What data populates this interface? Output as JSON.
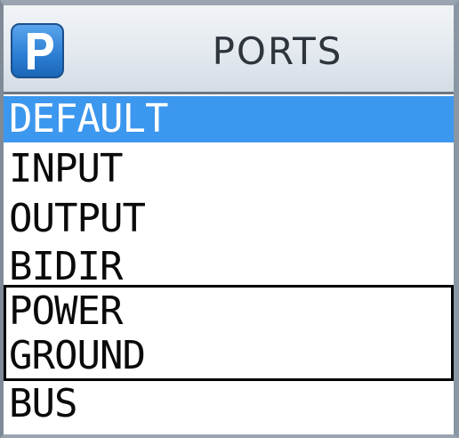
{
  "header": {
    "icon": "ports-p-icon",
    "icon_letter": "P",
    "title": "PORTS"
  },
  "ports_list": {
    "items": [
      {
        "label": "DEFAULT",
        "selected": true
      },
      {
        "label": "INPUT",
        "selected": false
      },
      {
        "label": "OUTPUT",
        "selected": false
      },
      {
        "label": "BIDIR",
        "selected": false
      },
      {
        "label": "POWER",
        "selected": false,
        "outlined": true
      },
      {
        "label": "GROUND",
        "selected": false,
        "outlined": true
      },
      {
        "label": "BUS",
        "selected": false
      }
    ]
  },
  "colors": {
    "selection": "#3c97ee",
    "icon_blue": "#2b7ed4",
    "outline": "#000000"
  }
}
